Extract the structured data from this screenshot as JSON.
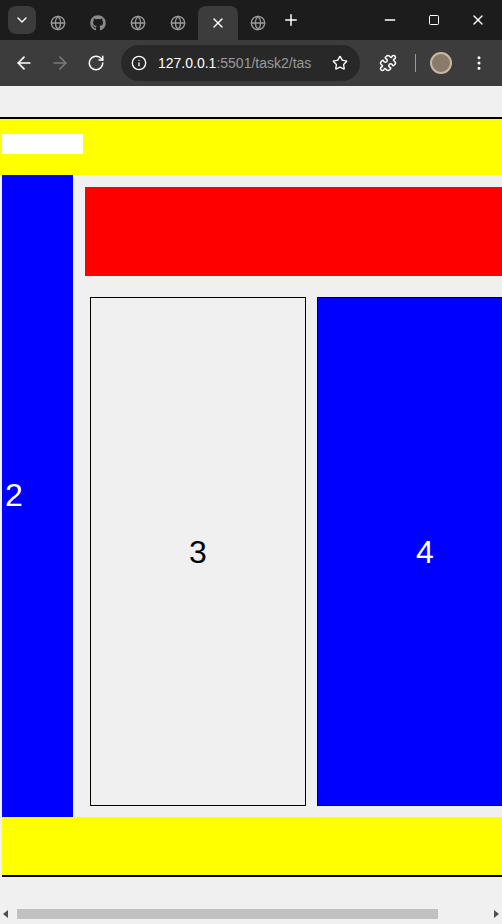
{
  "browser": {
    "tabs": [
      {
        "kind": "globe",
        "selected": false
      },
      {
        "kind": "github",
        "selected": false
      },
      {
        "kind": "globe",
        "selected": false
      },
      {
        "kind": "globe",
        "selected": false
      },
      {
        "kind": "globe",
        "selected": true
      },
      {
        "kind": "globe",
        "selected": false
      }
    ],
    "url": {
      "host": "127.0.0.1",
      "path": ":5501/task2/tas"
    },
    "forward_disabled": true
  },
  "page": {
    "sidebar": {
      "label": "2",
      "color": "#0000ff"
    },
    "cards": [
      {
        "label": "3",
        "color": "#f0f0f0",
        "text_color": "#000000"
      },
      {
        "label": "4",
        "color": "#0000ff",
        "text_color": "#ffffff"
      }
    ],
    "scrollbar": {
      "level": 0.9
    }
  }
}
